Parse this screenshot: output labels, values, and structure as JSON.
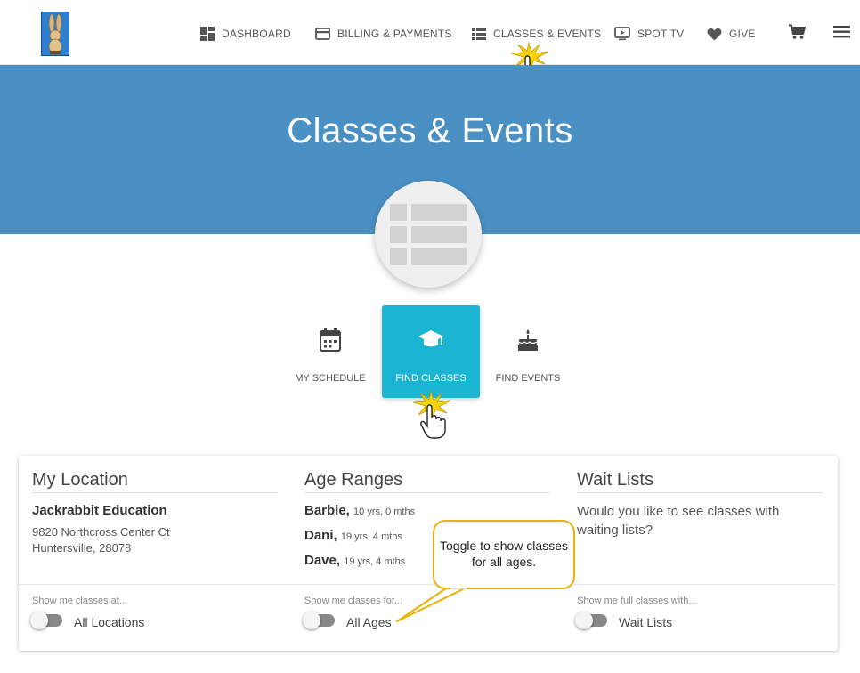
{
  "nav": {
    "items": [
      {
        "label": "DASHBOARD",
        "icon": "dashboard-icon"
      },
      {
        "label": "BILLING & PAYMENTS",
        "icon": "credit-card-icon"
      },
      {
        "label": "CLASSES & EVENTS",
        "icon": "list-icon"
      },
      {
        "label": "SPOT TV",
        "icon": "tv-play-icon"
      },
      {
        "label": "GIVE",
        "icon": "heart-icon"
      }
    ],
    "cart_icon": "cart-icon",
    "menu_icon": "hamburger-menu-icon"
  },
  "banner": {
    "title": "Classes & Events"
  },
  "subnav": {
    "items": [
      {
        "label": "MY SCHEDULE",
        "icon": "calendar-icon"
      },
      {
        "label": "FIND CLASSES",
        "icon": "graduation-cap-icon"
      },
      {
        "label": "FIND EVENTS",
        "icon": "birthday-cake-icon"
      }
    ],
    "active": "FIND CLASSES"
  },
  "location": {
    "title": "My Location",
    "name": "Jackrabbit Education",
    "address1": "9820 Northcross Center Ct",
    "address2": "Huntersville, 28078",
    "show_label": "Show me classes at...",
    "toggle_label": "All Locations"
  },
  "ages": {
    "title": "Age Ranges",
    "people": [
      {
        "name": "Barbie,",
        "age": "10 yrs, 0 mths"
      },
      {
        "name": "Dani,",
        "age": "19 yrs, 4 mths"
      },
      {
        "name": "Dave,",
        "age": "19 yrs, 4 mths"
      }
    ],
    "show_label": "Show me classes for...",
    "toggle_label": "All Ages"
  },
  "waitlists": {
    "title": "Wait Lists",
    "question": "Would you like to see classes with waiting lists?",
    "show_label": "Show me full classes with...",
    "toggle_label": "Wait Lists"
  },
  "callout": {
    "text": "Toggle to show classes for all ages."
  },
  "colors": {
    "banner": "#4a90c2",
    "active_tab": "#1ab5d3",
    "callout_border": "#e8b10b"
  }
}
